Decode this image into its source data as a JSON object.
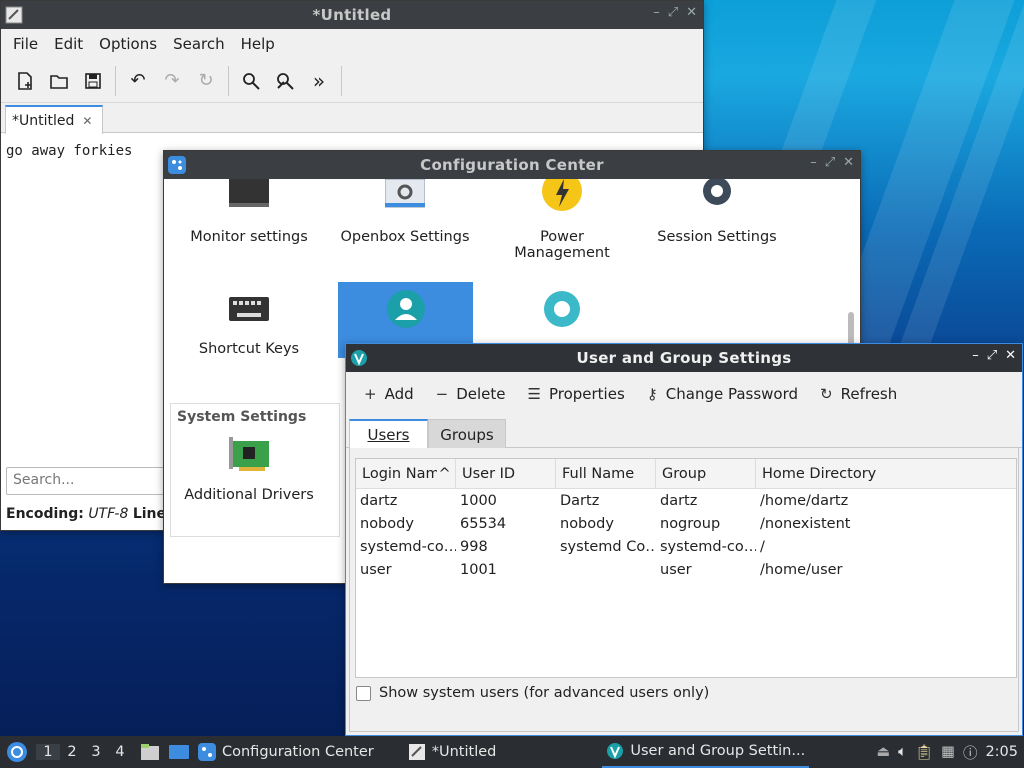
{
  "editor": {
    "title": "*Untitled",
    "menu": [
      "File",
      "Edit",
      "Options",
      "Search",
      "Help"
    ],
    "tab_label": "*Untitled",
    "content": "go away forkies",
    "search_placeholder": "Search...",
    "status_encoding_label": "Encoding:",
    "status_encoding_value": "UTF-8",
    "status_lines_label": "Lines"
  },
  "config": {
    "title": "Configuration Center",
    "items": [
      "Monitor settings",
      "Openbox Settings",
      "Power Management",
      "Session Settings",
      "Shortcut Keys"
    ],
    "section_label": "System Settings",
    "system_items": [
      "Additional Drivers"
    ]
  },
  "users": {
    "title": "User and Group Settings",
    "toolbar": {
      "add": "Add",
      "delete": "Delete",
      "properties": "Properties",
      "change_password": "Change Password",
      "refresh": "Refresh"
    },
    "tabs": [
      "Users",
      "Groups"
    ],
    "columns": [
      "Login Name",
      "User ID",
      "Full Name",
      "Group",
      "Home Directory"
    ],
    "rows": [
      [
        "dartz",
        "1000",
        "Dartz",
        "dartz",
        "/home/dartz"
      ],
      [
        "nobody",
        "65534",
        "nobody",
        "nogroup",
        "/nonexistent"
      ],
      [
        "systemd-co…",
        "998",
        "systemd Co…",
        "systemd-co…",
        "/"
      ],
      [
        "user",
        "1001",
        "",
        "user",
        "/home/user"
      ]
    ],
    "show_system_label": "Show system users (for advanced users only)"
  },
  "taskbar": {
    "desktops": [
      "1",
      "2",
      "3",
      "4"
    ],
    "tasks": [
      "Configuration Center",
      "*Untitled",
      "User and Group Settin..."
    ],
    "clock": "2:05"
  },
  "colors": {
    "accent": "#3c8ce0",
    "titlebar": "#3b3f44",
    "taskbar": "#2a2d32"
  }
}
